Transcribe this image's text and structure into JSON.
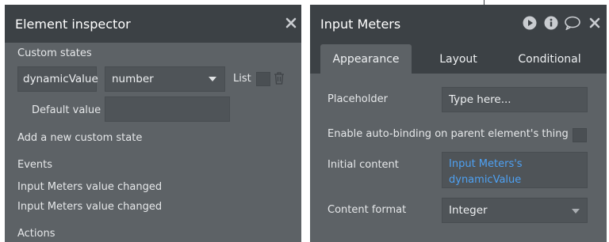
{
  "inspector": {
    "title": "Element inspector",
    "close_icon": "close-icon",
    "custom_states_label": "Custom states",
    "state_name": "dynamicValue",
    "state_type": "number",
    "list_label": "List",
    "trash_icon": "trash-icon",
    "default_value_label": "Default value",
    "default_value": "",
    "add_state_link": "Add a new custom state",
    "events_label": "Events",
    "events": [
      "Input Meters value changed",
      "Input Meters value changed"
    ],
    "actions_label": "Actions"
  },
  "property_editor": {
    "title": "Input Meters",
    "icons": [
      "play-icon",
      "info-icon",
      "comment-icon",
      "close-icon"
    ],
    "tabs": [
      "Appearance",
      "Layout",
      "Conditional"
    ],
    "active_tab": "Appearance",
    "placeholder_label": "Placeholder",
    "placeholder_value": "Type here...",
    "autobinding_label": "Enable auto-binding on parent element's thing",
    "initial_content_label": "Initial content",
    "initial_content_line1": "Input Meters's",
    "initial_content_line2": "dynamicValue",
    "content_format_label": "Content format",
    "content_format_value": "Integer"
  },
  "colors": {
    "panel_bg": "#5d6266",
    "header_bg": "#3c4145",
    "dynamic_expression": "#4ea1f3"
  }
}
